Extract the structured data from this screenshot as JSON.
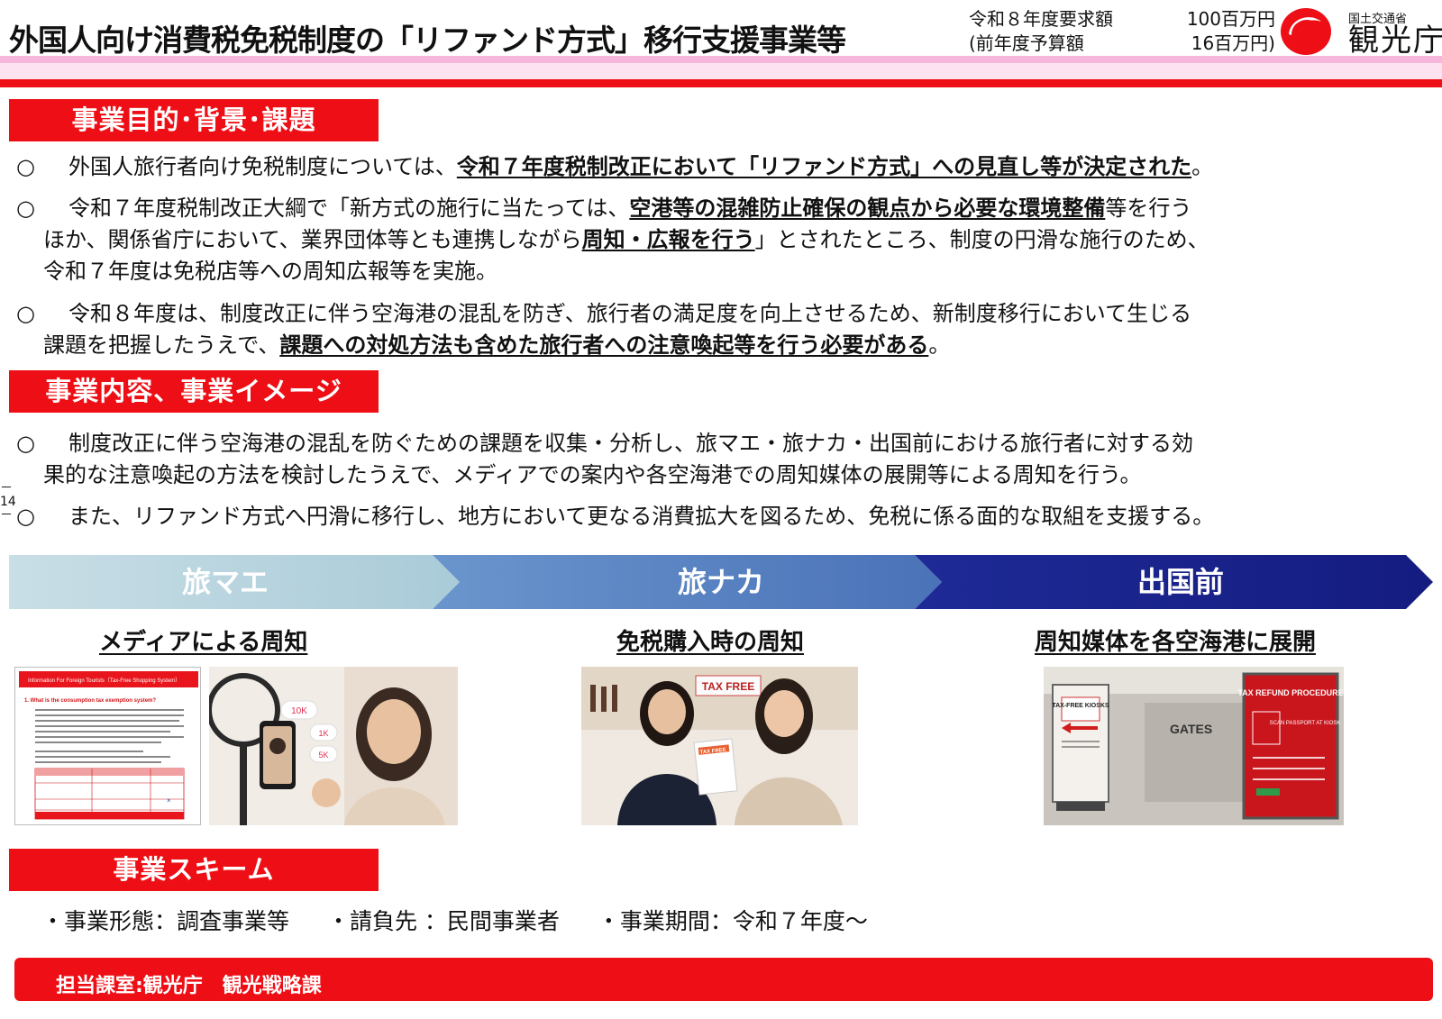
{
  "header": {
    "title": "外国人向け消費税免税制度の「リファンド方式」移行支援事業等",
    "budget_label": "令和８年度要求額",
    "budget_value": "100百万円",
    "prev_label": "(前年度予算額",
    "prev_value": "16百万円)",
    "ministry": "国土交通省",
    "agency": "観光庁",
    "colors": {
      "accent": "#ee0f16",
      "pink": "#f7b6dc"
    }
  },
  "sections": {
    "purpose": "事業目的･背景･課題",
    "content": "事業内容、事業イメージ",
    "scheme": "事業スキーム"
  },
  "purpose_bullets": [
    {
      "marker": "○",
      "a": "外国人旅行者向け免税制度については、",
      "b": "令和７年度税制改正において「リファンド方式」への見直し等が決定された",
      "c": "。"
    },
    {
      "marker": "○",
      "a": "令和７年度税制改正大綱で「新方式の施行に当たっては、",
      "b": "空港等の混雑防止確保の観点から必要な環境整備",
      "c": "等を行う",
      "d": "ほか、関係省庁において、業界団体等とも連携しながら",
      "e": "周知・広報を行う",
      "f": "」とされたところ、制度の円滑な施行のため、",
      "g": "令和７年度は免税店等への周知広報等を実施。"
    },
    {
      "marker": "○",
      "a": "令和８年度は、制度改正に伴う空海港の混乱を防ぎ、旅行者の満足度を向上させるため、新制度移行において生じる",
      "b": "課題を把握したうえで、",
      "c": "課題への対処方法も含めた旅行者への注意喚起等を行う必要がある",
      "d": "。"
    }
  ],
  "content_bullets": [
    {
      "marker": "○",
      "a": "制度改正に伴う空海港の混乱を防ぐための課題を収集・分析し、旅マエ・旅ナカ・出国前における旅行者に対する効",
      "b": "果的な注意喚起の方法を検討したうえで、メディアでの案内や各空海港での周知媒体の展開等による周知を行う。"
    },
    {
      "marker": "○",
      "a": "また、リファンド方式へ円滑に移行し、地方において更なる消費拡大を図るため、免税に係る面的な取組を支援する。"
    }
  ],
  "side_mark": "－14－",
  "flow": {
    "stages": [
      "旅マエ",
      "旅ナカ",
      "出国前"
    ],
    "colors": [
      "#b4d3de",
      "#5b86c3",
      "#18218a"
    ]
  },
  "subheads": [
    "メディアによる周知",
    "免税購入時の周知",
    "周知媒体を各空海港に展開"
  ],
  "images": {
    "flyer_title": "Information For Foreign Tourists（Tax-Free Shopping System）",
    "flyer_q": "1.  What is the consumption tax exemption system?",
    "likes": [
      "10K",
      "1K",
      "5K"
    ],
    "tax_free_sign": "TAX FREE",
    "tax_free_card": "TAX FREE",
    "kiosk_sign": "TAX-FREE KIOSKS",
    "gates": "GATES",
    "refund_sign": "TAX REFUND PROCEDURE",
    "refund_step": "SCAN PASSPORT AT KIOSK"
  },
  "scheme": {
    "form": "・事業形態：調査事業等",
    "contractor": "・請負先 ：民間事業者",
    "period": "・事業期間：令和７年度～"
  },
  "footer": "担当課室:観光庁　観光戦略課"
}
